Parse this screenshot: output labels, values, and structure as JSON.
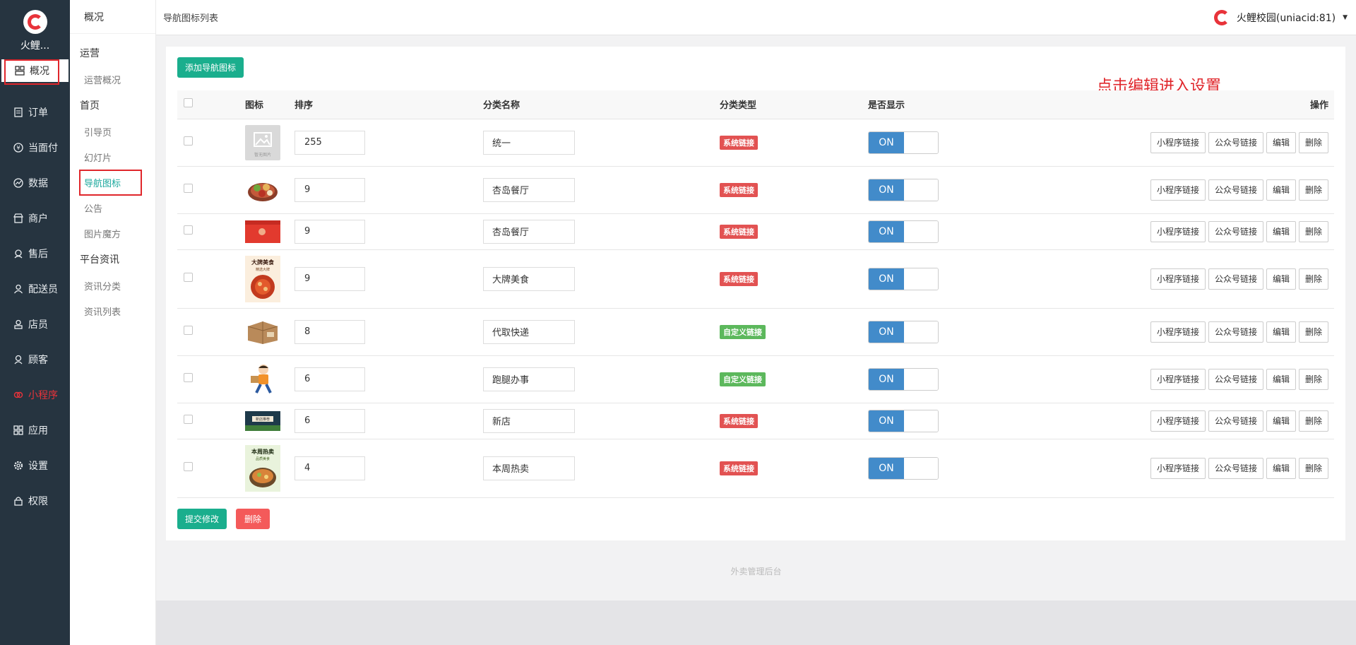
{
  "brand": {
    "name": "火鲤..."
  },
  "main_nav": [
    {
      "label": "概况",
      "icon": "dashboard-icon"
    },
    {
      "label": "订单",
      "icon": "order-icon"
    },
    {
      "label": "当面付",
      "icon": "yen-icon"
    },
    {
      "label": "数据",
      "icon": "chart-icon"
    },
    {
      "label": "商户",
      "icon": "store-icon"
    },
    {
      "label": "售后",
      "icon": "service-icon"
    },
    {
      "label": "配送员",
      "icon": "courier-icon"
    },
    {
      "label": "店员",
      "icon": "staff-icon"
    },
    {
      "label": "顾客",
      "icon": "customer-icon"
    },
    {
      "label": "小程序",
      "icon": "miniapp-icon"
    },
    {
      "label": "应用",
      "icon": "apps-icon"
    },
    {
      "label": "设置",
      "icon": "gear-icon"
    },
    {
      "label": "权限",
      "icon": "lock-icon"
    }
  ],
  "sub_nav": {
    "title": "概况",
    "groups": [
      {
        "label": "运营",
        "items": [
          "运营概况"
        ]
      },
      {
        "label": "首页",
        "items": [
          "引导页",
          "幻灯片",
          "导航图标",
          "公告",
          "图片魔方"
        ]
      },
      {
        "label": "平台资讯",
        "items": [
          "资讯分类",
          "资讯列表"
        ]
      }
    ]
  },
  "topbar": {
    "title": "导航图标列表",
    "account": "火鲤校园(uniacid:81)"
  },
  "toolbar": {
    "add_label": "添加导航图标"
  },
  "hint": "点击编辑进入设置",
  "table": {
    "headers": [
      "图标",
      "排序",
      "分类名称",
      "分类类型",
      "是否显示",
      "操作"
    ],
    "rows": [
      {
        "order": "255",
        "name": "统一",
        "type": "系统链接",
        "show": "ON"
      },
      {
        "order": "9",
        "name": "杏岛餐厅",
        "type": "系统链接",
        "show": "ON"
      },
      {
        "order": "9",
        "name": "杏岛餐厅",
        "type": "系统链接",
        "show": "ON"
      },
      {
        "order": "9",
        "name": "大牌美食",
        "type": "系统链接",
        "show": "ON"
      },
      {
        "order": "8",
        "name": "代取快递",
        "type": "自定义链接",
        "show": "ON"
      },
      {
        "order": "6",
        "name": "跑腿办事",
        "type": "自定义链接",
        "show": "ON"
      },
      {
        "order": "6",
        "name": "新店",
        "type": "系统链接",
        "show": "ON"
      },
      {
        "order": "4",
        "name": "本周热卖",
        "type": "系统链接",
        "show": "ON"
      }
    ],
    "row_actions": [
      "小程序链接",
      "公众号链接",
      "编辑",
      "删除"
    ]
  },
  "thumb_text": {
    "placeholder": "暂无图片",
    "brand_food": "大牌美食",
    "brand_food_sub": "精选大牌",
    "new_shop": "新店推荐",
    "hot_week": "本周热卖",
    "hot_week_sub": "品质美食"
  },
  "actions": {
    "submit_label": "提交修改",
    "delete_label": "删除"
  },
  "footer": {
    "text": "外卖管理后台"
  },
  "colors": {
    "accent_green": "#1aae8d",
    "danger_red": "#f45a5a",
    "switch_blue": "#428bca",
    "nav_dark": "#263440"
  }
}
